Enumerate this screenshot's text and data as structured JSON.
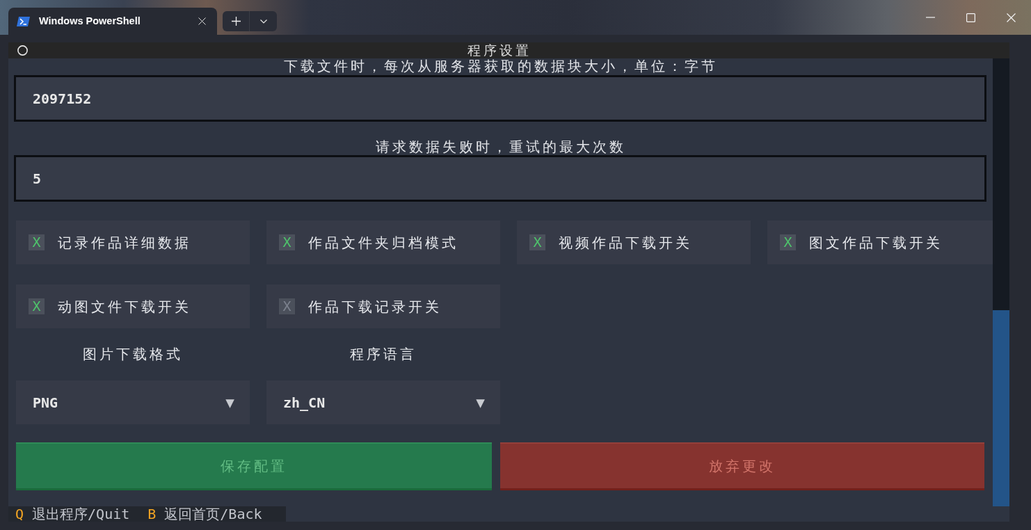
{
  "window": {
    "tab": {
      "title": "Windows PowerShell",
      "selected": true
    }
  },
  "header": {
    "title": "程序设置"
  },
  "fields": [
    {
      "label": "下载文件时，每次从服务器获取的数据块大小，单位：字节",
      "value": "2097152"
    },
    {
      "label": "请求数据失败时，重试的最大次数",
      "value": "5"
    }
  ],
  "toggles": [
    {
      "label": "记录作品详细数据",
      "mark": "X",
      "checked": true
    },
    {
      "label": "作品文件夹归档模式",
      "mark": "X",
      "checked": true
    },
    {
      "label": "视频作品下载开关",
      "mark": "X",
      "checked": true
    },
    {
      "label": "图文作品下载开关",
      "mark": "X",
      "checked": true
    },
    {
      "label": "动图文件下载开关",
      "mark": "X",
      "checked": true
    },
    {
      "label": "作品下载记录开关",
      "mark": "X",
      "checked": false
    }
  ],
  "selects": [
    {
      "label": "图片下载格式",
      "value": "PNG",
      "arrow": "▼"
    },
    {
      "label": "程序语言",
      "value": "zh_CN",
      "arrow": "▼"
    }
  ],
  "buttons": [
    {
      "label": "保存配置",
      "kind": "save"
    },
    {
      "label": "放弃更改",
      "kind": "discard"
    }
  ],
  "footer": [
    {
      "key": "Q",
      "label": "退出程序/Quit"
    },
    {
      "key": "B",
      "label": "返回首页/Back"
    }
  ]
}
